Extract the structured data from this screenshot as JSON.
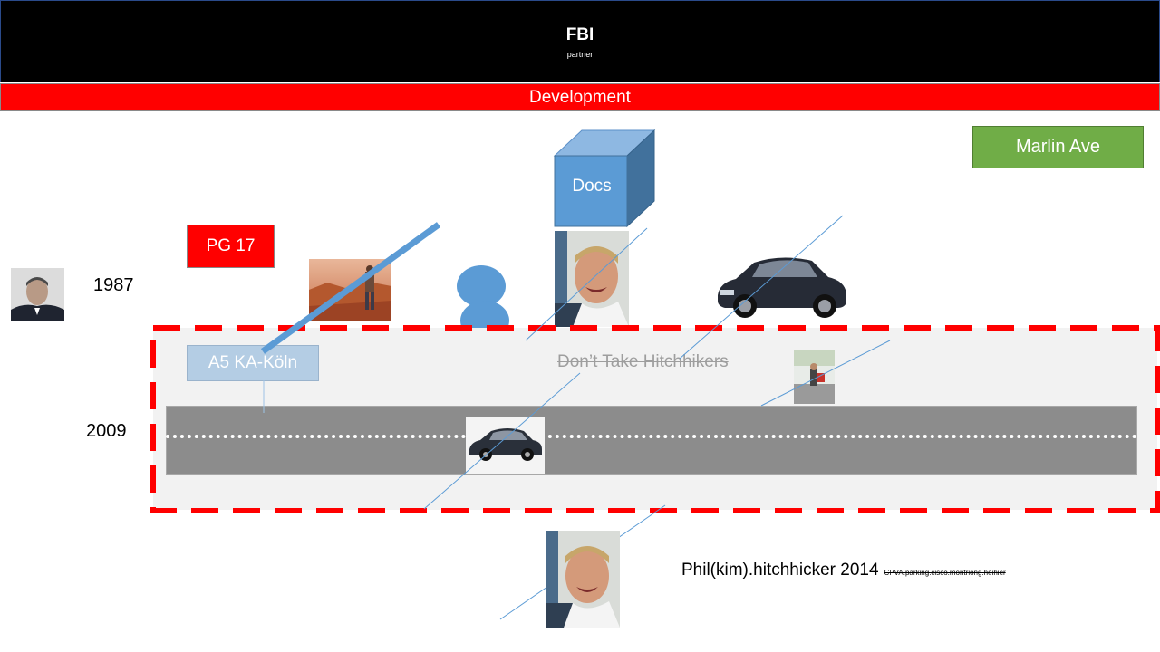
{
  "header": {
    "title": "FBI",
    "subtitle": "partner"
  },
  "banner": {
    "label": "Development"
  },
  "labels": {
    "marlin": "Marlin Ave",
    "pg17": "PG 17",
    "docs": "Docs",
    "a5": "A5 KA-Köln",
    "dont_take": "Don’t Take Hitchhikers",
    "year_1987": "1987",
    "year_2009": "2009",
    "phil": "Phil(kim).hitchhicker ",
    "phil_year": "2014",
    "small_note": "CPVA.parking.cisco.montriong.heihier"
  },
  "colors": {
    "header_bg": "#000000",
    "banner_red": "#ff0000",
    "green_box": "#70ad47",
    "blue_shape": "#5b9bd5",
    "frame_dash": "#ff0000",
    "road_grey": "#8c8c8c"
  }
}
